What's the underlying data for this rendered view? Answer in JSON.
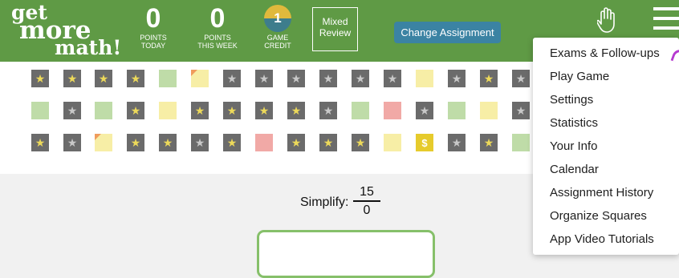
{
  "logo": {
    "line1": "get",
    "line2": "more",
    "line3": "math!"
  },
  "stats": {
    "points_today": {
      "value": "0",
      "label_1": "POINTS",
      "label_2": "TODAY"
    },
    "points_week": {
      "value": "0",
      "label_1": "POINTS",
      "label_2": "THIS WEEK"
    },
    "game_credit": {
      "value": "1",
      "label_1": "GAME",
      "label_2": "CREDIT"
    }
  },
  "assignment": {
    "mode_line1": "Mixed",
    "mode_line2": "Review",
    "change_label": "Change Assignment"
  },
  "icons": {
    "hand": "raise-hand-icon",
    "menu": "hamburger-menu-icon",
    "star": "star-icon"
  },
  "colors": {
    "header": "#5f9a45",
    "button": "#3b83a3",
    "star": "#ecd95a",
    "correct": "#bfdca8",
    "attempted": "#f7eea6",
    "wrong": "#f1a9a6"
  },
  "squares": [
    [
      "star",
      "star",
      "star",
      "star",
      "green",
      "partial",
      "gray",
      "gray",
      "gray",
      "gray",
      "gray",
      "gray",
      "yellow",
      "gray",
      "star",
      "gray"
    ],
    [
      "green",
      "gray",
      "green",
      "star",
      "yellow",
      "star",
      "star",
      "star",
      "star",
      "gray",
      "green",
      "red",
      "gray",
      "green",
      "yellow",
      "gray"
    ],
    [
      "star",
      "gray",
      "partial",
      "star",
      "star",
      "gray",
      "star",
      "red",
      "star",
      "star",
      "star",
      "yellow",
      "dollar",
      "gray",
      "star",
      "green"
    ]
  ],
  "dollar_symbol": "$",
  "problem": {
    "prompt": "Simplify:",
    "numerator": "15",
    "denominator": "0"
  },
  "menu": {
    "items": [
      "Exams & Follow-ups",
      "Play Game",
      "Settings",
      "Statistics",
      "Your Info",
      "Calendar",
      "Assignment History",
      "Organize Squares",
      "App Video Tutorials"
    ]
  }
}
